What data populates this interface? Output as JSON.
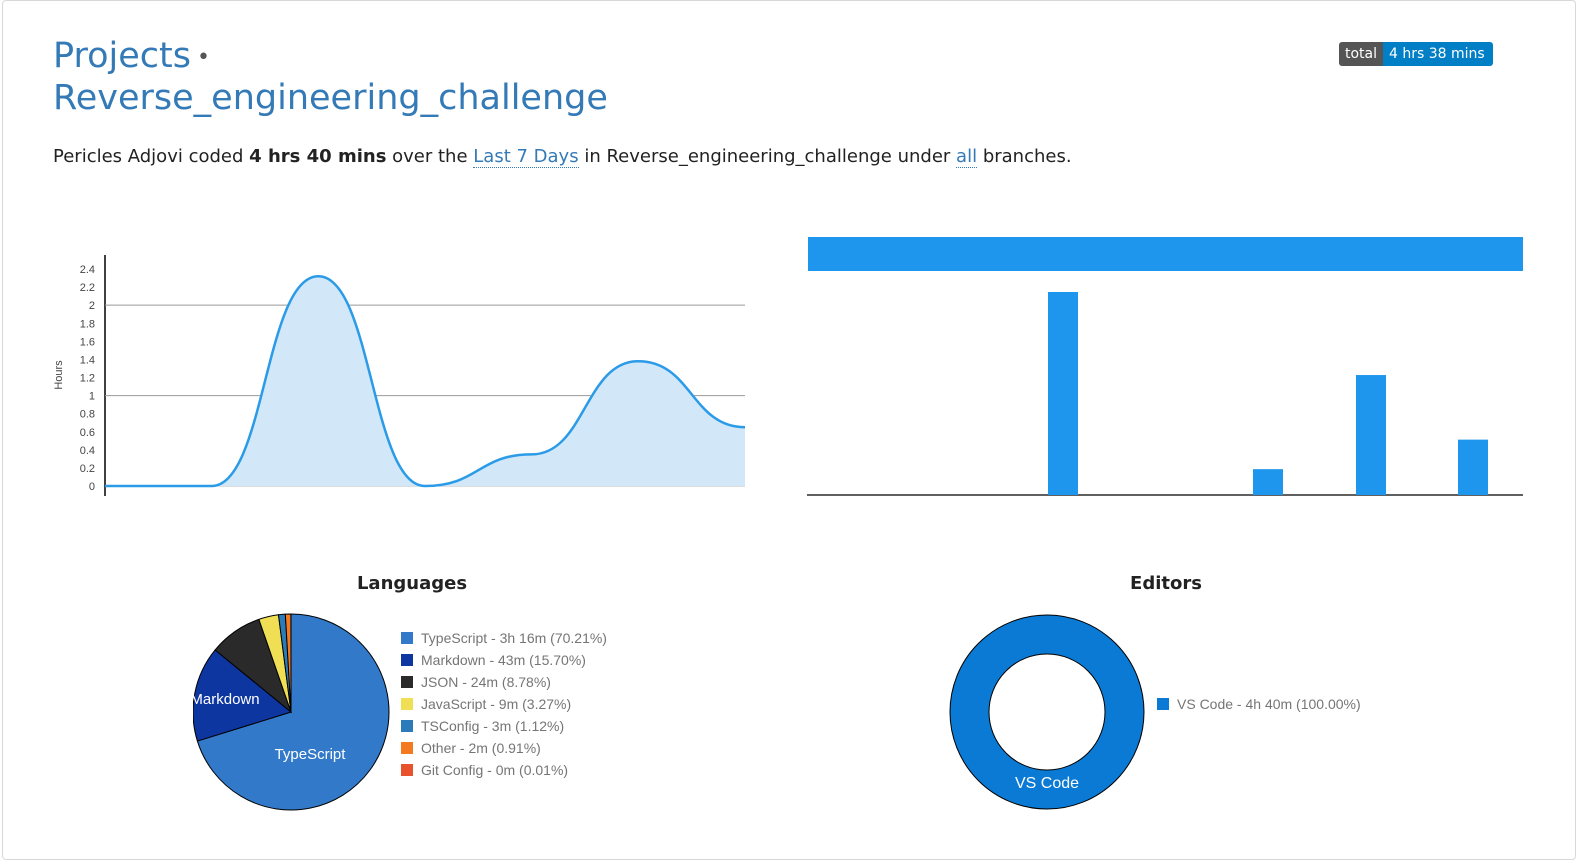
{
  "header": {
    "crumb_link": "Projects",
    "crumb_sep": "•",
    "project_name": "Reverse_engineering_challenge"
  },
  "badge": {
    "label": "total",
    "value": "4 hrs 38 mins"
  },
  "summary": {
    "user": "Pericles Adjovi",
    "text_coded": "coded",
    "duration": "4 hrs 40 mins",
    "text_over": "over the",
    "range_link": "Last 7 Days",
    "text_in": "in",
    "project": "Reverse_engineering_challenge",
    "text_under": "under",
    "branch_link": "all",
    "text_branches": "branches."
  },
  "chart_data": [
    {
      "type": "area",
      "ylabel": "Hours",
      "ylim": [
        0,
        2.4
      ],
      "yticks": [
        "2.4",
        "2.2",
        "2",
        "1.8",
        "1.6",
        "1.4",
        "1.2",
        "1",
        "0.8",
        "0.6",
        "0.4",
        "0.2",
        "0"
      ],
      "x": [
        0,
        1,
        2,
        3,
        4,
        5,
        6
      ],
      "values": [
        0,
        0,
        2.32,
        0,
        0.35,
        1.38,
        0.65
      ],
      "gridlines": [
        1,
        2
      ],
      "color": "#2b9be8",
      "fill": "#d2e8f9"
    },
    {
      "type": "bar",
      "header_bar_color": "#1e96ee",
      "categories": [
        "",
        "",
        "",
        "",
        "",
        "",
        ""
      ],
      "values": [
        0,
        0,
        2.2,
        0,
        0.28,
        1.3,
        0.6
      ],
      "ylim": [
        0,
        2.2
      ],
      "color": "#1e96ee"
    },
    {
      "type": "pie",
      "title": "Languages",
      "series": [
        {
          "name": "TypeScript",
          "legend": "TypeScript - 3h 16m (70.21%)",
          "value": 70.21,
          "color": "#3279c9",
          "slice_label": "TypeScript"
        },
        {
          "name": "Markdown",
          "legend": "Markdown - 43m (15.70%)",
          "value": 15.7,
          "color": "#0e36a0",
          "slice_label": "Markdown"
        },
        {
          "name": "JSON",
          "legend": "JSON - 24m (8.78%)",
          "value": 8.78,
          "color": "#2a2a2a"
        },
        {
          "name": "JavaScript",
          "legend": "JavaScript - 9m (3.27%)",
          "value": 3.27,
          "color": "#f0df55"
        },
        {
          "name": "TSConfig",
          "legend": "TSConfig - 3m (1.12%)",
          "value": 1.12,
          "color": "#2b7bba"
        },
        {
          "name": "Other",
          "legend": "Other - 2m (0.91%)",
          "value": 0.91,
          "color": "#f47a1f"
        },
        {
          "name": "Git Config",
          "legend": "Git Config - 0m (0.01%)",
          "value": 0.01,
          "color": "#e8532e"
        }
      ]
    },
    {
      "type": "pie",
      "title": "Editors",
      "donut": true,
      "series": [
        {
          "name": "VS Code",
          "legend": "VS Code - 4h 40m (100.00%)",
          "value": 100,
          "color": "#0a7ad4",
          "slice_label": "VS Code"
        }
      ]
    }
  ]
}
